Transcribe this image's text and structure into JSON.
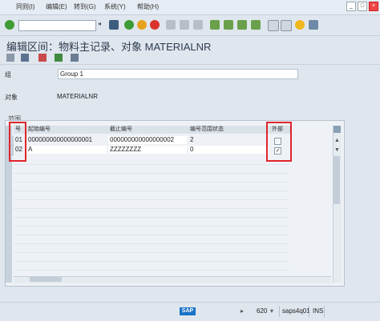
{
  "menu": {
    "items": [
      "同则(I)",
      "编辑(E)",
      "转到(G)",
      "系统(Y)",
      "帮助(H)"
    ]
  },
  "window_controls": {
    "minimize": "_",
    "maximize": "□",
    "close": "×"
  },
  "toolbar": {
    "command_value": ""
  },
  "page": {
    "title": "编辑区间：物料主记录、对象 MATERIALNR"
  },
  "form": {
    "group_label": "组",
    "group_value": "Group 1",
    "object_label": "对象",
    "object_value": "MATERIALNR"
  },
  "grid": {
    "section_label": "范围",
    "headers": [
      "号",
      "起始编号",
      "截止编号",
      "编号范围状态",
      "外部"
    ],
    "rows": [
      {
        "no": "01",
        "from": "000000000000000001",
        "to": "000000000000000002",
        "status": "2",
        "external": false
      },
      {
        "no": "02",
        "from": "A",
        "to": "ZZZZZZZZ",
        "status": "0",
        "external": true
      }
    ]
  },
  "status": {
    "client": "620",
    "system": "saps4q01",
    "mode": "INS",
    "logo": "SAP"
  },
  "colors": {
    "highlight": "#e0252b",
    "ok_green": "#3e9c35"
  }
}
